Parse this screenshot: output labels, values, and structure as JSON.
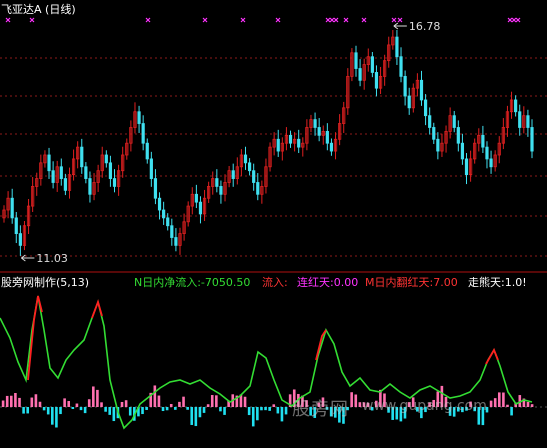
{
  "header": {
    "title": "飞亚达A (日线)"
  },
  "price_labels": {
    "high": "16.78",
    "low": "11.03"
  },
  "indicator": {
    "name": "股旁网制作(5,13)",
    "legend": [
      {
        "text": "N日内净流入:-7050.50",
        "color": "#33dd33"
      },
      {
        "text": "流入:",
        "color": "#ff3333"
      },
      {
        "text": "连红天:0.00",
        "color": "#ff33ff"
      },
      {
        "text": "M日内翻红天:7.00",
        "color": "#ff3333"
      },
      {
        "text": "走熊天:1.0!",
        "color": "#ffffff"
      }
    ]
  },
  "watermark": {
    "site": "股旁网",
    "url": "www.gupang.com"
  },
  "colors": {
    "up": "#e02020",
    "down": "#40e0f0",
    "grid": "#8b1a1a",
    "marker": "#ff33ff",
    "flow_green": "#33dd33",
    "flow_red": "#ff2020",
    "bar_pink": "#ff70b0",
    "bar_cyan": "#20e0f0"
  },
  "chart_data": [
    {
      "type": "candlestick",
      "title": "飞亚达A (日线)",
      "annotations": [
        {
          "label": "16.78",
          "kind": "high"
        },
        {
          "label": "11.03",
          "kind": "low"
        }
      ],
      "closes": [
        12.2,
        12.5,
        12.0,
        11.6,
        11.3,
        11.8,
        12.3,
        12.8,
        13.0,
        13.4,
        13.6,
        13.2,
        12.9,
        13.3,
        13.0,
        12.7,
        13.1,
        13.5,
        13.8,
        13.3,
        13.0,
        12.6,
        12.9,
        13.2,
        13.6,
        13.4,
        13.0,
        12.8,
        13.2,
        13.6,
        13.9,
        14.3,
        14.7,
        14.4,
        13.9,
        13.5,
        13.0,
        12.5,
        12.2,
        12.0,
        11.8,
        11.5,
        11.3,
        11.6,
        11.9,
        12.3,
        12.6,
        12.4,
        12.1,
        12.5,
        12.8,
        13.0,
        12.8,
        12.6,
        12.9,
        13.2,
        13.0,
        13.3,
        13.6,
        13.4,
        13.2,
        12.9,
        12.6,
        12.8,
        13.3,
        13.8,
        14.0,
        13.7,
        13.9,
        14.1,
        13.9,
        14.0,
        13.8,
        13.9,
        14.3,
        14.5,
        14.3,
        14.1,
        14.2,
        13.9,
        13.7,
        14.0,
        14.4,
        14.8,
        15.6,
        16.2,
        15.8,
        15.5,
        15.9,
        16.1,
        15.7,
        15.3,
        15.6,
        16.0,
        16.4,
        16.6,
        16.1,
        15.6,
        15.1,
        14.8,
        15.3,
        15.5,
        15.0,
        14.6,
        14.3,
        14.0,
        13.7,
        13.9,
        14.2,
        14.6,
        14.3,
        13.9,
        13.5,
        13.1,
        13.5,
        13.9,
        14.1,
        13.8,
        13.5,
        13.3,
        13.6,
        13.9,
        14.3,
        14.7,
        15.0,
        14.7,
        14.3,
        14.6,
        14.3,
        13.7
      ]
    },
    {
      "type": "line+bar",
      "title": "股旁网制作(5,13)",
      "series": [
        {
          "name": "N日内净流入",
          "values": [
            -7050.5
          ]
        },
        {
          "name": "连红天",
          "values": [
            0.0
          ]
        },
        {
          "name": "M日内翻红天",
          "values": [
            7.0
          ]
        },
        {
          "name": "走熊天",
          "values": [
            1.0
          ]
        }
      ]
    }
  ]
}
